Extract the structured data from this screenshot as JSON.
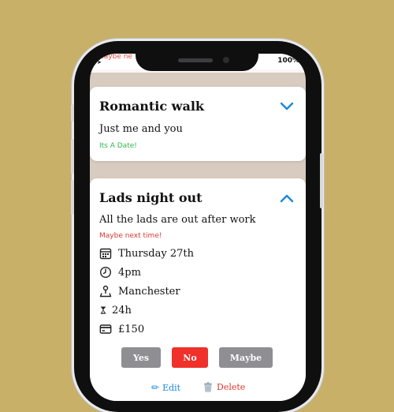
{
  "statusbar": {
    "carrier_text": "Maybe ne",
    "battery": "100%"
  },
  "events": [
    {
      "title": "Romantic walk",
      "description": "Just me and you",
      "status_text": "Its A Date!",
      "status_color": "#2fb84a",
      "expanded": false
    },
    {
      "title": "Lads night out",
      "description": "All the lads are out after work",
      "status_text": "Maybe next time!",
      "status_color": "#e0372e",
      "expanded": true,
      "details": {
        "date": "Thursday 27th",
        "time": "4pm",
        "location": "Manchester",
        "duration": "24h",
        "cost": "£150"
      },
      "rsvp": {
        "yes_label": "Yes",
        "no_label": "No",
        "maybe_label": "Maybe",
        "selected": "No"
      },
      "actions": {
        "edit_label": "Edit",
        "delete_label": "Delete"
      }
    }
  ],
  "colors": {
    "background": "#c9b069",
    "selected_button": "#f0302a",
    "unselected_button": "#8e8e93",
    "accent": "#1a88e0"
  }
}
